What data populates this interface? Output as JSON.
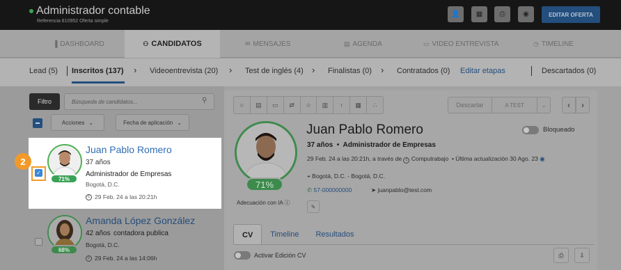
{
  "header": {
    "title": "Administrador contable",
    "subtitle": "Referencia 810952 Oferta simple",
    "edit_button": "EDITAR OFERTA",
    "icons": [
      "add-user-icon",
      "qr-icon",
      "print-icon",
      "eye-icon"
    ]
  },
  "nav": {
    "tabs": [
      {
        "label": "DASHBOARD",
        "icon": "chart-icon"
      },
      {
        "label": "CANDIDATOS",
        "icon": "people-icon"
      },
      {
        "label": "MENSAJES",
        "icon": "mail-icon"
      },
      {
        "label": "AGENDA",
        "icon": "calendar-icon"
      },
      {
        "label": "VIDEO ENTREVISTA",
        "icon": "monitor-icon"
      },
      {
        "label": "TIMELINE",
        "icon": "clock-icon"
      }
    ],
    "active": "CANDIDATOS"
  },
  "stages": {
    "items": [
      "Lead (5)",
      "Inscritos (137)",
      "Videoentrevista (20)",
      "Test de inglés (4)",
      "Finalistas (0)",
      "Contratados (0)"
    ],
    "edit_link": "Editar etapas",
    "discarded": "Descartados (0)"
  },
  "filters": {
    "filter_button": "Filtro",
    "search_placeholder": "Búsqueda de candidatos...",
    "actions_dropdown": "Acciones",
    "date_dropdown": "Fecha de aplicación"
  },
  "candidates": [
    {
      "name": "Juan Pablo Romero",
      "age": "37 años",
      "role": "Administrador de Empresas",
      "location": "Bogotá, D.C.",
      "date": "29 Feb. 24 a las 20:21h",
      "match": "71%"
    },
    {
      "name": "Amanda López González",
      "age": "42 años",
      "role": "contadora publica",
      "location": "Bogotá, D.C.",
      "date": "29 Feb. 24 a las 14:06h",
      "match": "68%"
    }
  ],
  "step_badge": "2",
  "profile": {
    "name": "Juan Pablo Romero",
    "age": "37 años",
    "title": "Administrador de Empresas",
    "applied": "29 Feb. 24 a las 20:21h, a través de",
    "source": "Computrabajo",
    "updated": "Última actualización 30 Ago. 23",
    "location": "Bogotá, D.C. - Bogotá, D.C.",
    "phone": "57-000000000",
    "email": "juanpablo@test.com",
    "match": "71%",
    "ai_label": "Adecuación con IA",
    "blocked_label": "Bloqueado",
    "discard_button": "Descartar",
    "test_button": "A TEST"
  },
  "profile_tabs": [
    "CV",
    "Timeline",
    "Resultados"
  ],
  "cv_edit_label": "Activar Edición CV"
}
